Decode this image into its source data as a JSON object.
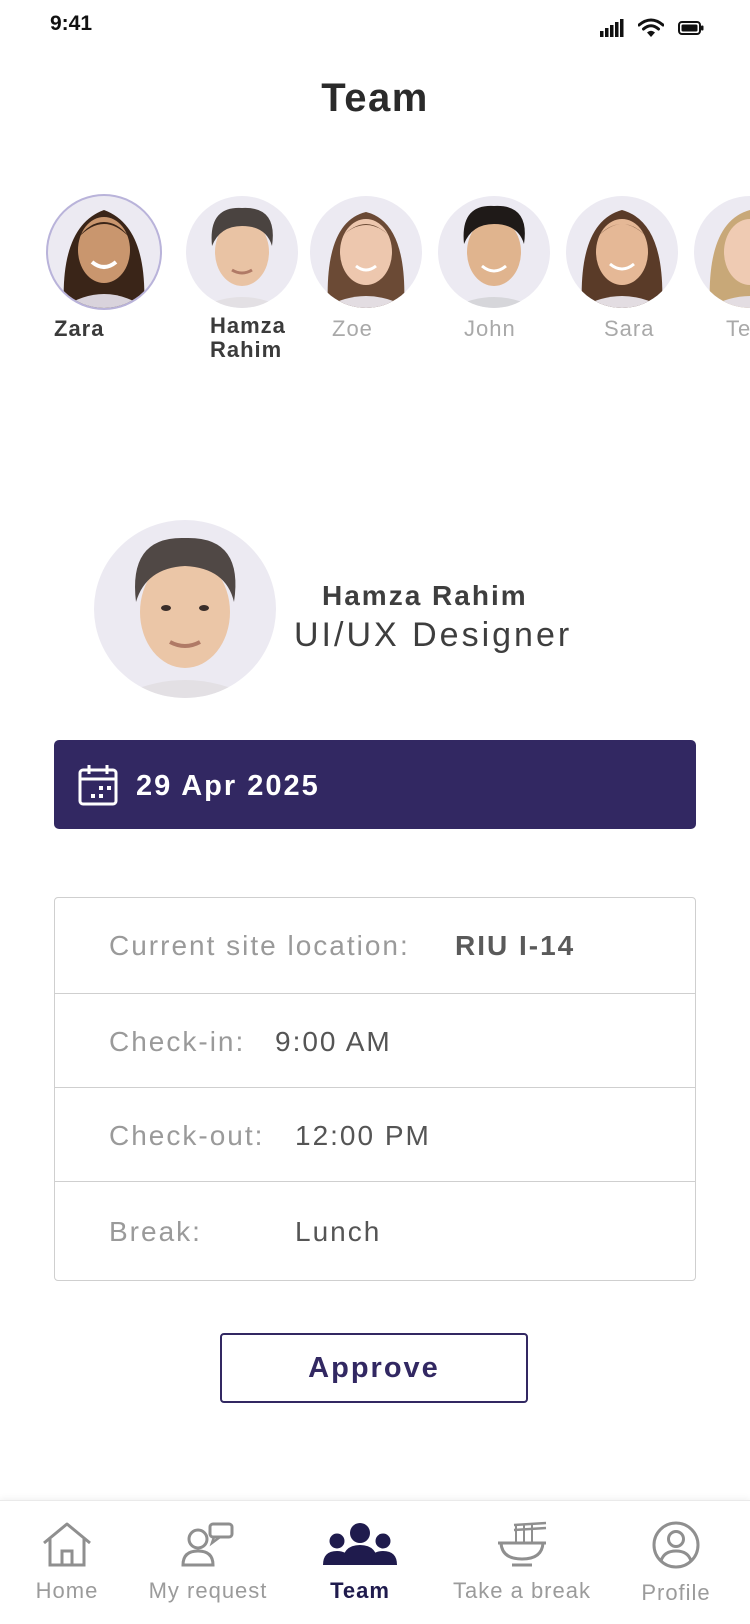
{
  "status_bar": {
    "time": "9:41"
  },
  "title": "Team",
  "team": [
    {
      "name": "Zara",
      "selected": true
    },
    {
      "name": "Hamza\nRahim",
      "selected": false
    },
    {
      "name": "Zoe",
      "selected": false
    },
    {
      "name": "John",
      "selected": false
    },
    {
      "name": "Sara",
      "selected": false
    },
    {
      "name": "Te",
      "selected": false
    }
  ],
  "profile": {
    "name": "Hamza Rahim",
    "role": "UI/UX Designer"
  },
  "date": "29 Apr 2025",
  "details": {
    "location_label": "Current site location:",
    "location_value": "RIU I-14",
    "checkin_label": "Check-in:",
    "checkin_value": "9:00 AM",
    "checkout_label": "Check-out:",
    "checkout_value": "12:00 PM",
    "break_label": "Break:",
    "break_value": "Lunch"
  },
  "approve_label": "Approve",
  "nav": {
    "home": "Home",
    "my_request": "My request",
    "team": "Team",
    "take_break": "Take a break",
    "profile": "Profile"
  },
  "colors": {
    "primary": "#322862",
    "nav_active": "#1f1b4d"
  }
}
